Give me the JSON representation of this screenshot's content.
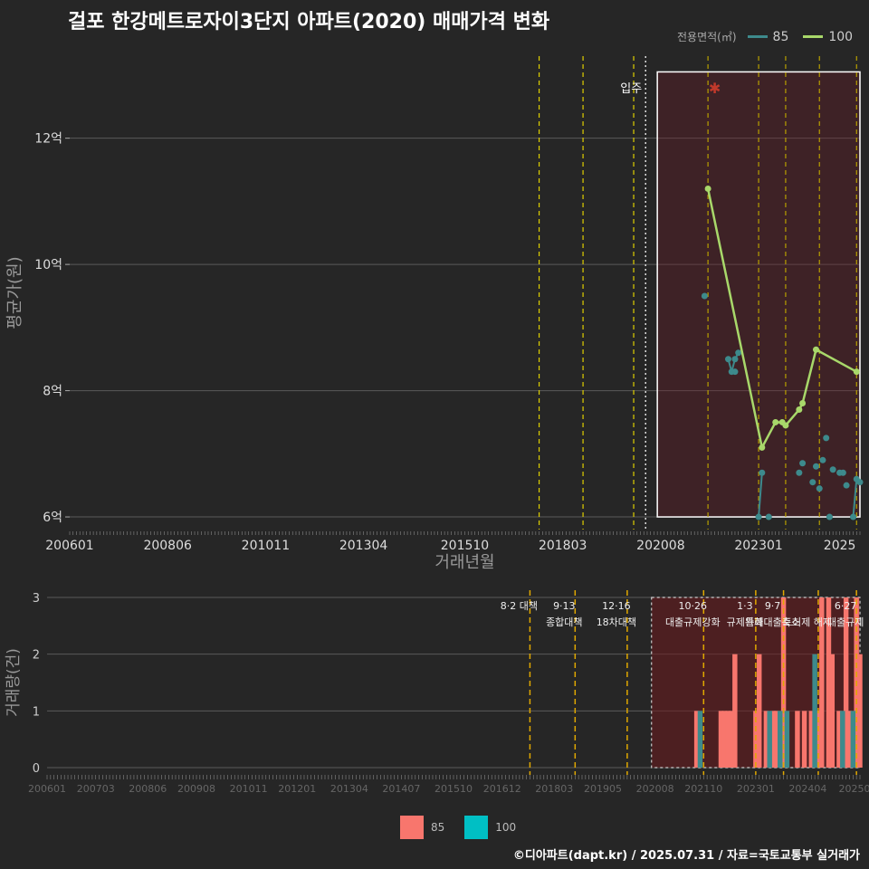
{
  "title": "걸포 한강메트로자이3단지 아파트(2020) 매매가격 변화",
  "legend_top": {
    "label": "전용면적(㎡)",
    "items": [
      {
        "name": "85",
        "color": "#3d8a8c"
      },
      {
        "name": "100",
        "color": "#a8d86a"
      }
    ]
  },
  "legend_bottom": {
    "items": [
      {
        "name": "85",
        "color": "#f8766d"
      },
      {
        "name": "100",
        "color": "#00bfc4"
      }
    ]
  },
  "footer": "©디아파트(dapt.kr) / 2025.07.31 / 자료=국토교통부 실거래가",
  "chart_data": [
    {
      "type": "line",
      "xlabel": "거래년월",
      "ylabel": "평균가(원)",
      "xlim": [
        "200601",
        "202507"
      ],
      "ylim": [
        5.8,
        13.3
      ],
      "x_ticks": [
        "200601",
        "200806",
        "201011",
        "201304",
        "201510",
        "201803",
        "202008",
        "202301",
        "2025"
      ],
      "y_ticks": [
        {
          "v": 6,
          "label": "6억"
        },
        {
          "v": 8,
          "label": "8억"
        },
        {
          "v": 10,
          "label": "10억"
        },
        {
          "v": 12,
          "label": "12억"
        }
      ],
      "move_in_label": "입주",
      "move_in_date": "2020.03",
      "highlight_box": {
        "x_from": "2020.07",
        "x_to": "2025.07",
        "y_from": 6.0,
        "y_to": 13.05
      },
      "policy_lines": [
        "2017.08",
        "2018.09",
        "2019.12",
        "2021.10",
        "2023.01",
        "2023.09",
        "2024.07",
        "2025.06"
      ],
      "star_point": {
        "x": "2021.12",
        "y": 12.8
      },
      "series": [
        {
          "name": "85",
          "color": "#3d8a8c",
          "points": [
            {
              "x": "2021.09",
              "y": 9.5
            },
            {
              "x": "2022.04",
              "y": 8.5
            },
            {
              "x": "2022.05",
              "y": 8.3
            },
            {
              "x": "2022.06",
              "y": 8.5
            },
            {
              "x": "2022.07",
              "y": 8.6
            },
            {
              "x": "2022.06",
              "y": 8.3
            },
            {
              "x": "2023.01",
              "y": 6.0
            },
            {
              "x": "2023.02",
              "y": 6.7
            },
            {
              "x": "2023.04",
              "y": 6.0
            },
            {
              "x": "2024.01",
              "y": 6.7
            },
            {
              "x": "2024.02",
              "y": 6.85
            },
            {
              "x": "2024.05",
              "y": 6.55
            },
            {
              "x": "2024.06",
              "y": 6.8
            },
            {
              "x": "2024.07",
              "y": 6.45
            },
            {
              "x": "2024.08",
              "y": 6.9
            },
            {
              "x": "2024.09",
              "y": 7.25
            },
            {
              "x": "2024.10",
              "y": 6.0
            },
            {
              "x": "2024.11",
              "y": 6.75
            },
            {
              "x": "2025.01",
              "y": 6.7
            },
            {
              "x": "2025.02",
              "y": 6.7
            },
            {
              "x": "2025.03",
              "y": 6.5
            },
            {
              "x": "2025.05",
              "y": 6.0
            },
            {
              "x": "2025.06",
              "y": 6.6
            },
            {
              "x": "2025.07",
              "y": 6.55
            }
          ]
        },
        {
          "name": "100",
          "color": "#a8d86a",
          "points": [
            {
              "x": "2021.10",
              "y": 11.2
            },
            {
              "x": "2023.02",
              "y": 7.1
            },
            {
              "x": "2023.06",
              "y": 7.5
            },
            {
              "x": "2023.08",
              "y": 7.5
            },
            {
              "x": "2023.09",
              "y": 7.45
            },
            {
              "x": "2024.01",
              "y": 7.7
            },
            {
              "x": "2024.02",
              "y": 7.8
            },
            {
              "x": "2024.06",
              "y": 8.65
            },
            {
              "x": "2025.06",
              "y": 8.3
            }
          ]
        }
      ]
    },
    {
      "type": "bar",
      "xlabel": "",
      "ylabel": "거래량(건)",
      "xlim": [
        "200601",
        "202507"
      ],
      "ylim": [
        0,
        3
      ],
      "x_ticks": [
        "200601",
        "200703",
        "200806",
        "200908",
        "201011",
        "201201",
        "201304",
        "201407",
        "201510",
        "201612",
        "201803",
        "201905",
        "202008",
        "202110",
        "202301",
        "202404",
        "20250"
      ],
      "y_ticks": [
        0,
        1,
        2,
        3
      ],
      "highlight_box": {
        "x_from": "2020.07",
        "x_to": "2025.07",
        "y_from": 0,
        "y_to": 3
      },
      "policies": [
        {
          "date": "2017.08",
          "label1": "8·2 대책",
          "label2": ""
        },
        {
          "date": "2018.09",
          "label1": "9·13",
          "label2": "종합대책"
        },
        {
          "date": "2019.12",
          "label1": "12·16",
          "label2": "18차대책"
        },
        {
          "date": "2021.10",
          "label1": "10·26",
          "label2": "대출규제강화"
        },
        {
          "date": "2023.01",
          "label1": "1·3",
          "label2": "규제완화"
        },
        {
          "date": "2023.09",
          "label1": "9·7",
          "label2": "특례대출축소"
        },
        {
          "date": "2024.07",
          "label1": "",
          "label2": "토허제 해제"
        },
        {
          "date": "2025.06",
          "label1": "6·27",
          "label2": "대출규제"
        }
      ],
      "series": [
        {
          "name": "85",
          "color": "#f8766d",
          "values": [
            {
              "x": "2021.08",
              "v": 1
            },
            {
              "x": "2022.03",
              "v": 1
            },
            {
              "x": "2022.04",
              "v": 1
            },
            {
              "x": "2022.05",
              "v": 1
            },
            {
              "x": "2022.06",
              "v": 1
            },
            {
              "x": "2022.07",
              "v": 2
            },
            {
              "x": "2023.01",
              "v": 1
            },
            {
              "x": "2023.02",
              "v": 2
            },
            {
              "x": "2023.04",
              "v": 1
            },
            {
              "x": "2023.06",
              "v": 1
            },
            {
              "x": "2023.07",
              "v": 1
            },
            {
              "x": "2023.09",
              "v": 3
            },
            {
              "x": "2024.01",
              "v": 1
            },
            {
              "x": "2024.03",
              "v": 1
            },
            {
              "x": "2024.05",
              "v": 1
            },
            {
              "x": "2024.07",
              "v": 1
            },
            {
              "x": "2024.08",
              "v": 3
            },
            {
              "x": "2024.10",
              "v": 3
            },
            {
              "x": "2024.11",
              "v": 2
            },
            {
              "x": "2025.01",
              "v": 1
            },
            {
              "x": "2025.03",
              "v": 3
            },
            {
              "x": "2025.04",
              "v": 1
            },
            {
              "x": "2025.06",
              "v": 3
            },
            {
              "x": "2025.07",
              "v": 2
            }
          ]
        },
        {
          "name": "100",
          "color": "#3d8a8c",
          "values": [
            {
              "x": "2021.09",
              "v": 1
            },
            {
              "x": "2023.05",
              "v": 1
            },
            {
              "x": "2023.08",
              "v": 1
            },
            {
              "x": "2023.10",
              "v": 1
            },
            {
              "x": "2024.06",
              "v": 2
            },
            {
              "x": "2025.02",
              "v": 1
            },
            {
              "x": "2025.05",
              "v": 1
            }
          ]
        }
      ]
    }
  ]
}
